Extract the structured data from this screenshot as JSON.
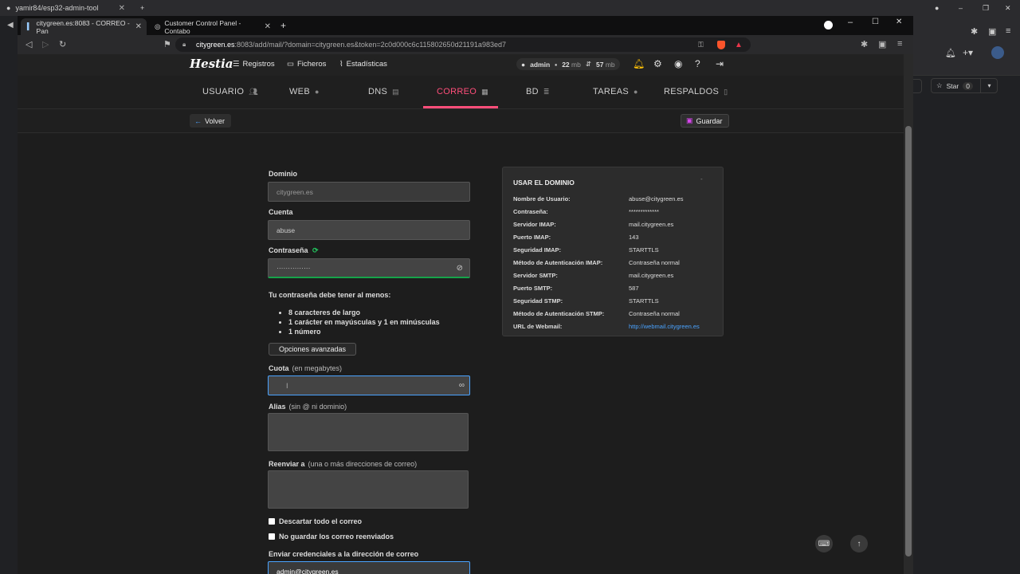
{
  "outer": {
    "tab1": "yamir84/esp32-admin-tool",
    "star_label": "Star",
    "star_count": "0"
  },
  "browser": {
    "tabs": [
      "citygreen.es:8083 - CORREO - Pan",
      "Customer Control Panel - Contabo"
    ],
    "url_host": "citygreen.es",
    "url_rest": ":8083/add/mail/?domain=citygreen.es&token=2c0d000c6c115802650d21191a983ed7"
  },
  "topnav": {
    "logo": "Hestia",
    "links": [
      "Registros",
      "Ficheros",
      "Estadísticas"
    ],
    "user": "admin",
    "disk": "22",
    "disk_unit": "mb",
    "bw": "57",
    "bw_unit": "mb"
  },
  "tabs": [
    "USUARIO",
    "WEB",
    "DNS",
    "CORREO",
    "BD",
    "TAREAS",
    "RESPALDOS"
  ],
  "actions": {
    "back": "Volver",
    "save": "Guardar"
  },
  "form": {
    "domain_label": "Dominio",
    "domain_value": "citygreen.es",
    "account_label": "Cuenta",
    "account_value": "abuse",
    "password_label": "Contraseña",
    "password_value": "···············",
    "req_title": "Tu contraseña debe tener al menos:",
    "req_items": [
      "8 caracteres de largo",
      "1 carácter en mayúsculas y 1 en minúsculas",
      "1 número"
    ],
    "advanced": "Opciones avanzadas",
    "quota_label": "Cuota",
    "quota_sub": "(en megabytes)",
    "alias_label": "Alias",
    "alias_sub": "(sin @ ni dominio)",
    "forward_label": "Reenviar a",
    "forward_sub": "(una o más direcciones de correo)",
    "discard": "Descartar todo el correo",
    "nostore": "No guardar los correo reenviados",
    "send_creds": "Enviar credenciales a la dirección de correo",
    "send_value": "admin@citygreen.es"
  },
  "info": {
    "title": "USAR EL DOMINIO",
    "rows": [
      {
        "k": "Nombre de Usuario:",
        "v": "abuse@citygreen.es"
      },
      {
        "k": "Contraseña:",
        "v": "*************"
      },
      {
        "k": "Servidor IMAP:",
        "v": "mail.citygreen.es"
      },
      {
        "k": "Puerto IMAP:",
        "v": "143"
      },
      {
        "k": "Seguridad IMAP:",
        "v": "STARTTLS"
      },
      {
        "k": "Método de Autenticación IMAP:",
        "v": "Contraseña normal"
      },
      {
        "k": "Servidor SMTP:",
        "v": "mail.citygreen.es"
      },
      {
        "k": "Puerto SMTP:",
        "v": "587"
      },
      {
        "k": "Seguridad STMP:",
        "v": "STARTTLS"
      },
      {
        "k": "Método de Autenticación STMP:",
        "v": "Contraseña normal"
      },
      {
        "k": "URL de Webmail:",
        "v": "http://webmail.citygreen.es"
      }
    ]
  },
  "colors": {
    "accent": "#ff4e7a",
    "link": "#4aa3ff",
    "save_icon": "#d946ef"
  }
}
